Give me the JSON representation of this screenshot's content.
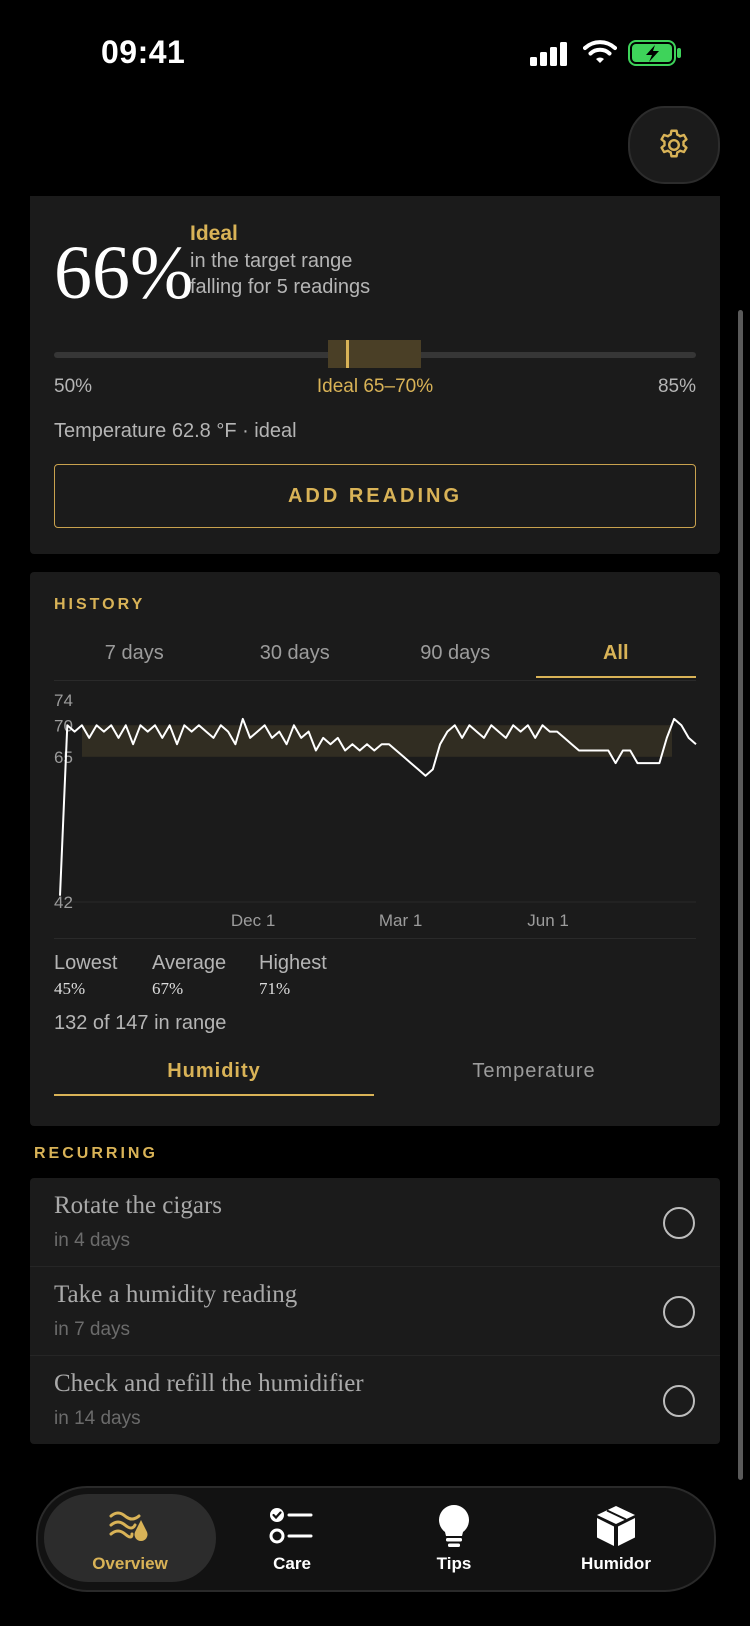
{
  "status_bar": {
    "time": "09:41"
  },
  "current": {
    "humidity": "66%",
    "status": "Ideal",
    "line1": "in the target range",
    "line2": "falling for 5 readings",
    "scale_min": "50%",
    "scale_ideal": "Ideal 65–70%",
    "scale_max": "85%",
    "scale_value": 66,
    "scale_from": 50,
    "scale_to": 85,
    "temperature": "Temperature 62.8 °F · ideal",
    "add_button": "ADD READING"
  },
  "history": {
    "label": "HISTORY",
    "range_tabs": [
      "7 days",
      "30 days",
      "90 days",
      "All"
    ],
    "active_range": "All",
    "lowest_label": "Lowest",
    "lowest": "45%",
    "average_label": "Average",
    "average": "67%",
    "highest_label": "Highest",
    "highest": "71%",
    "in_range": "132 of 147 in range",
    "metric_tabs": [
      "Humidity",
      "Temperature"
    ],
    "active_metric": "Humidity"
  },
  "chart_data": {
    "type": "line",
    "y_ticks": [
      "74",
      "70",
      "65",
      "42"
    ],
    "ylim": [
      42,
      74
    ],
    "ideal_band": [
      65,
      70
    ],
    "x_ticks": [
      "Dec 1",
      "Mar 1",
      "Jun 1"
    ],
    "series": [
      {
        "values": [
          43,
          70,
          69,
          70,
          68,
          70,
          69,
          70,
          68,
          70,
          67,
          70,
          69,
          70,
          68,
          70,
          67,
          70,
          69,
          70,
          69,
          68,
          70,
          69,
          67,
          71,
          68,
          69,
          70,
          68,
          69,
          67,
          70,
          68,
          69,
          66,
          68,
          67,
          68,
          66,
          67,
          66,
          67,
          66,
          67,
          67,
          66,
          65,
          64,
          63,
          62,
          63,
          67,
          69,
          70,
          68,
          70,
          69,
          68,
          70,
          69,
          68,
          70,
          69,
          70,
          68,
          70,
          69,
          69,
          68,
          67,
          66,
          66,
          66,
          66,
          66,
          64,
          66,
          66,
          64,
          64,
          64,
          64,
          68,
          71,
          70,
          68,
          67
        ]
      }
    ]
  },
  "recurring": {
    "label": "RECURRING",
    "tasks": [
      {
        "title": "Rotate the cigars",
        "due": "in 4 days"
      },
      {
        "title": "Take a humidity reading",
        "due": "in 7 days"
      },
      {
        "title": "Check and refill the humidifier",
        "due": "in 14 days"
      }
    ]
  },
  "tab_bar": {
    "items": [
      "Overview",
      "Care",
      "Tips",
      "Humidor"
    ],
    "active": "Overview"
  },
  "colors": {
    "accent": "#d9b357",
    "card": "#1b1b1b",
    "background": "#000000"
  }
}
